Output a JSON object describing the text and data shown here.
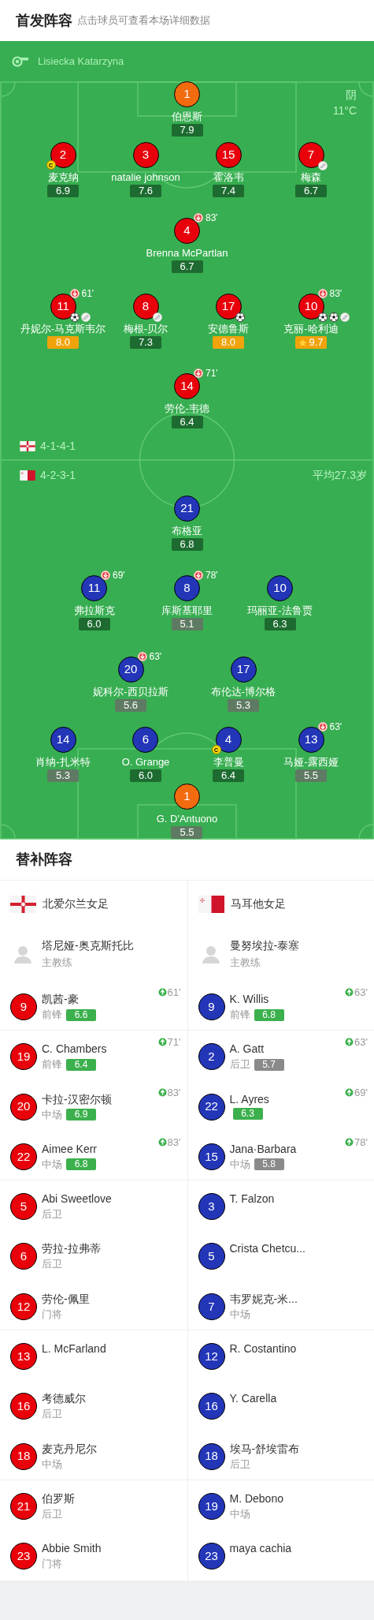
{
  "header": {
    "title": "首发阵容",
    "subtitle": "点击球员可查看本场详细数据"
  },
  "pitch": {
    "referee": "Lisiecka Katarzyna",
    "weather": "阴",
    "temperature": "11°C",
    "home": {
      "flag": {
        "kind": "northern-ireland"
      },
      "formation": "4-1-4-1",
      "rows": [
        [
          {
            "number": "1",
            "name": "伯恩斯",
            "color": "#f26b0f",
            "rating": {
              "value": "7.9",
              "color": "#1d6b30"
            }
          }
        ],
        [
          {
            "number": "2",
            "name": "麦克纳",
            "color": "#e8000b",
            "badge": "C",
            "rating": {
              "value": "6.9",
              "color": "#1d6b30"
            }
          },
          {
            "number": "3",
            "name": "natalie johnson",
            "color": "#e8000b",
            "rating": {
              "value": "7.6",
              "color": "#1d6b30"
            }
          },
          {
            "number": "15",
            "name": "霍洛韦",
            "color": "#e8000b",
            "rating": {
              "value": "7.4",
              "color": "#1d6b30"
            }
          },
          {
            "number": "7",
            "name": "梅森",
            "color": "#e8000b",
            "events": [
              {
                "kind": "assist"
              }
            ],
            "rating": {
              "value": "6.7",
              "color": "#1d6b30"
            }
          }
        ],
        [
          {
            "number": "4",
            "name": "Brenna McPartlan",
            "color": "#e8000b",
            "off": "83'",
            "rating": {
              "value": "6.7",
              "color": "#1d6b30"
            }
          }
        ],
        [
          {
            "number": "11",
            "name": "丹妮尔-马克斯韦尔",
            "color": "#e8000b",
            "off": "61'",
            "events": [
              {
                "kind": "goal"
              },
              {
                "kind": "assist"
              }
            ],
            "rating": {
              "value": "8.0",
              "color": "#f0a30a"
            }
          },
          {
            "number": "8",
            "name": "梅根-贝尔",
            "color": "#e8000b",
            "events": [
              {
                "kind": "assist"
              }
            ],
            "rating": {
              "value": "7.3",
              "color": "#1d6b30"
            }
          },
          {
            "number": "17",
            "name": "安德鲁斯",
            "color": "#e8000b",
            "events": [
              {
                "kind": "goal"
              }
            ],
            "rating": {
              "value": "8.0",
              "color": "#f0a30a"
            }
          },
          {
            "number": "10",
            "name": "克丽-哈利迪",
            "color": "#e8000b",
            "off": "83'",
            "events": [
              {
                "kind": "goal"
              },
              {
                "kind": "goal"
              },
              {
                "kind": "assist"
              }
            ],
            "rating": {
              "value": "9.7",
              "color": "#f0a30a",
              "best": true
            }
          }
        ],
        [
          {
            "number": "14",
            "name": "劳伦-韦德",
            "color": "#e8000b",
            "off": "71'",
            "rating": {
              "value": "6.4",
              "color": "#1d6b30"
            }
          }
        ]
      ]
    },
    "away": {
      "flag": {
        "kind": "malta"
      },
      "formation": "4-2-3-1",
      "average_age": "平均27.3岁",
      "rows": [
        [
          {
            "number": "21",
            "name": "布格亚",
            "color": "#2336b8",
            "rating": {
              "value": "6.8",
              "color": "#1d6b30"
            }
          }
        ],
        [
          {
            "number": "11",
            "name": "弗拉斯克",
            "color": "#2336b8",
            "off": "69'",
            "rating": {
              "value": "6.0",
              "color": "#1d6b30"
            }
          },
          {
            "number": "8",
            "name": "库斯基耶里",
            "color": "#2336b8",
            "off": "78'",
            "rating": {
              "value": "5.1",
              "color": "#5f7a63"
            }
          },
          {
            "number": "10",
            "name": "玛丽亚-法鲁贾",
            "color": "#2336b8",
            "rating": {
              "value": "6.3",
              "color": "#1d6b30"
            }
          }
        ],
        [
          {
            "number": "20",
            "name": "妮科尔-西贝拉斯",
            "color": "#2336b8",
            "off": "63'",
            "rating": {
              "value": "5.6",
              "color": "#5f7a63"
            }
          },
          {
            "number": "17",
            "name": "布伦达-博尔格",
            "color": "#2336b8",
            "rating": {
              "value": "5.3",
              "color": "#5f7a63"
            }
          }
        ],
        [
          {
            "number": "14",
            "name": "肖纳-扎米特",
            "color": "#2336b8",
            "rating": {
              "value": "5.3",
              "color": "#5f7a63"
            }
          },
          {
            "number": "6",
            "name": "O. Grange",
            "color": "#2336b8",
            "rating": {
              "value": "6.0",
              "color": "#1d6b30"
            }
          },
          {
            "number": "4",
            "name": "李普曼",
            "color": "#2336b8",
            "badge": "C",
            "rating": {
              "value": "6.4",
              "color": "#1d6b30"
            }
          },
          {
            "number": "13",
            "name": "马娅-露西娅",
            "color": "#2336b8",
            "off": "63'",
            "rating": {
              "value": "5.5",
              "color": "#5f7a63"
            }
          }
        ],
        [
          {
            "number": "1",
            "name": "G. D'Antuono",
            "color": "#f26b0f",
            "rating": {
              "value": "5.5",
              "color": "#5f7a63"
            }
          }
        ]
      ]
    }
  },
  "substitutes": {
    "title": "替补阵容",
    "teams": [
      {
        "name": "北爱尔兰女足",
        "flag": {
          "kind": "northern-ireland"
        },
        "color": "#e8000b",
        "coach": {
          "name": "塔尼娅-奥克斯托比",
          "role": "主教练"
        },
        "players": [
          {
            "number": "9",
            "name": "凯茜-豪",
            "position": "前锋",
            "rating": {
              "value": "6.6",
              "color": "#3cb04d"
            },
            "on": "61'"
          },
          {
            "number": "19",
            "name": "C. Chambers",
            "position": "前锋",
            "rating": {
              "value": "6.4",
              "color": "#3cb04d"
            },
            "on": "71'"
          },
          {
            "number": "20",
            "name": "卡拉-汉密尔顿",
            "position": "中场",
            "rating": {
              "value": "6.9",
              "color": "#3cb04d"
            },
            "on": "83'"
          },
          {
            "number": "22",
            "name": "Aimee Kerr",
            "position": "中场",
            "rating": {
              "value": "6.8",
              "color": "#3cb04d"
            },
            "on": "83'"
          },
          {
            "number": "5",
            "name": "Abi Sweetlove",
            "position": "后卫"
          },
          {
            "number": "6",
            "name": "劳拉-拉弗蒂",
            "position": "后卫"
          },
          {
            "number": "12",
            "name": "劳伦-佩里",
            "position": "门将"
          },
          {
            "number": "13",
            "name": "L. McFarland"
          },
          {
            "number": "16",
            "name": "考德威尔",
            "position": "后卫"
          },
          {
            "number": "18",
            "name": "麦克丹尼尔",
            "position": "中场"
          },
          {
            "number": "21",
            "name": "伯罗斯",
            "position": "后卫"
          },
          {
            "number": "23",
            "name": "Abbie Smith",
            "position": "门将"
          }
        ]
      },
      {
        "name": "马耳他女足",
        "flag": {
          "kind": "malta"
        },
        "color": "#2336b8",
        "coach": {
          "name": "曼努埃拉-泰塞",
          "role": "主教练"
        },
        "players": [
          {
            "number": "9",
            "name": "K. Willis",
            "position": "前锋",
            "rating": {
              "value": "6.8",
              "color": "#3cb04d"
            },
            "on": "63'"
          },
          {
            "number": "2",
            "name": "A. Gatt",
            "position": "后卫",
            "rating": {
              "value": "5.7",
              "color": "#8a8a8a"
            },
            "on": "63'"
          },
          {
            "number": "22",
            "name": "L. Ayres",
            "rating": {
              "value": "6.3",
              "color": "#3cb04d"
            },
            "on": "69'"
          },
          {
            "number": "15",
            "name": "Jana·Barbara",
            "position": "中场",
            "rating": {
              "value": "5.8",
              "color": "#8a8a8a"
            },
            "on": "78'"
          },
          {
            "number": "3",
            "name": "T. Falzon"
          },
          {
            "number": "5",
            "name": "Crista Chetcu..."
          },
          {
            "number": "7",
            "name": "韦罗妮克-米...",
            "position": "中场"
          },
          {
            "number": "12",
            "name": "R. Costantino"
          },
          {
            "number": "16",
            "name": "Y. Carella"
          },
          {
            "number": "18",
            "name": "埃马-舒埃雷布",
            "position": "后卫"
          },
          {
            "number": "19",
            "name": "M. Debono",
            "position": "中场"
          },
          {
            "number": "23",
            "name": "maya cachia"
          }
        ]
      }
    ]
  }
}
